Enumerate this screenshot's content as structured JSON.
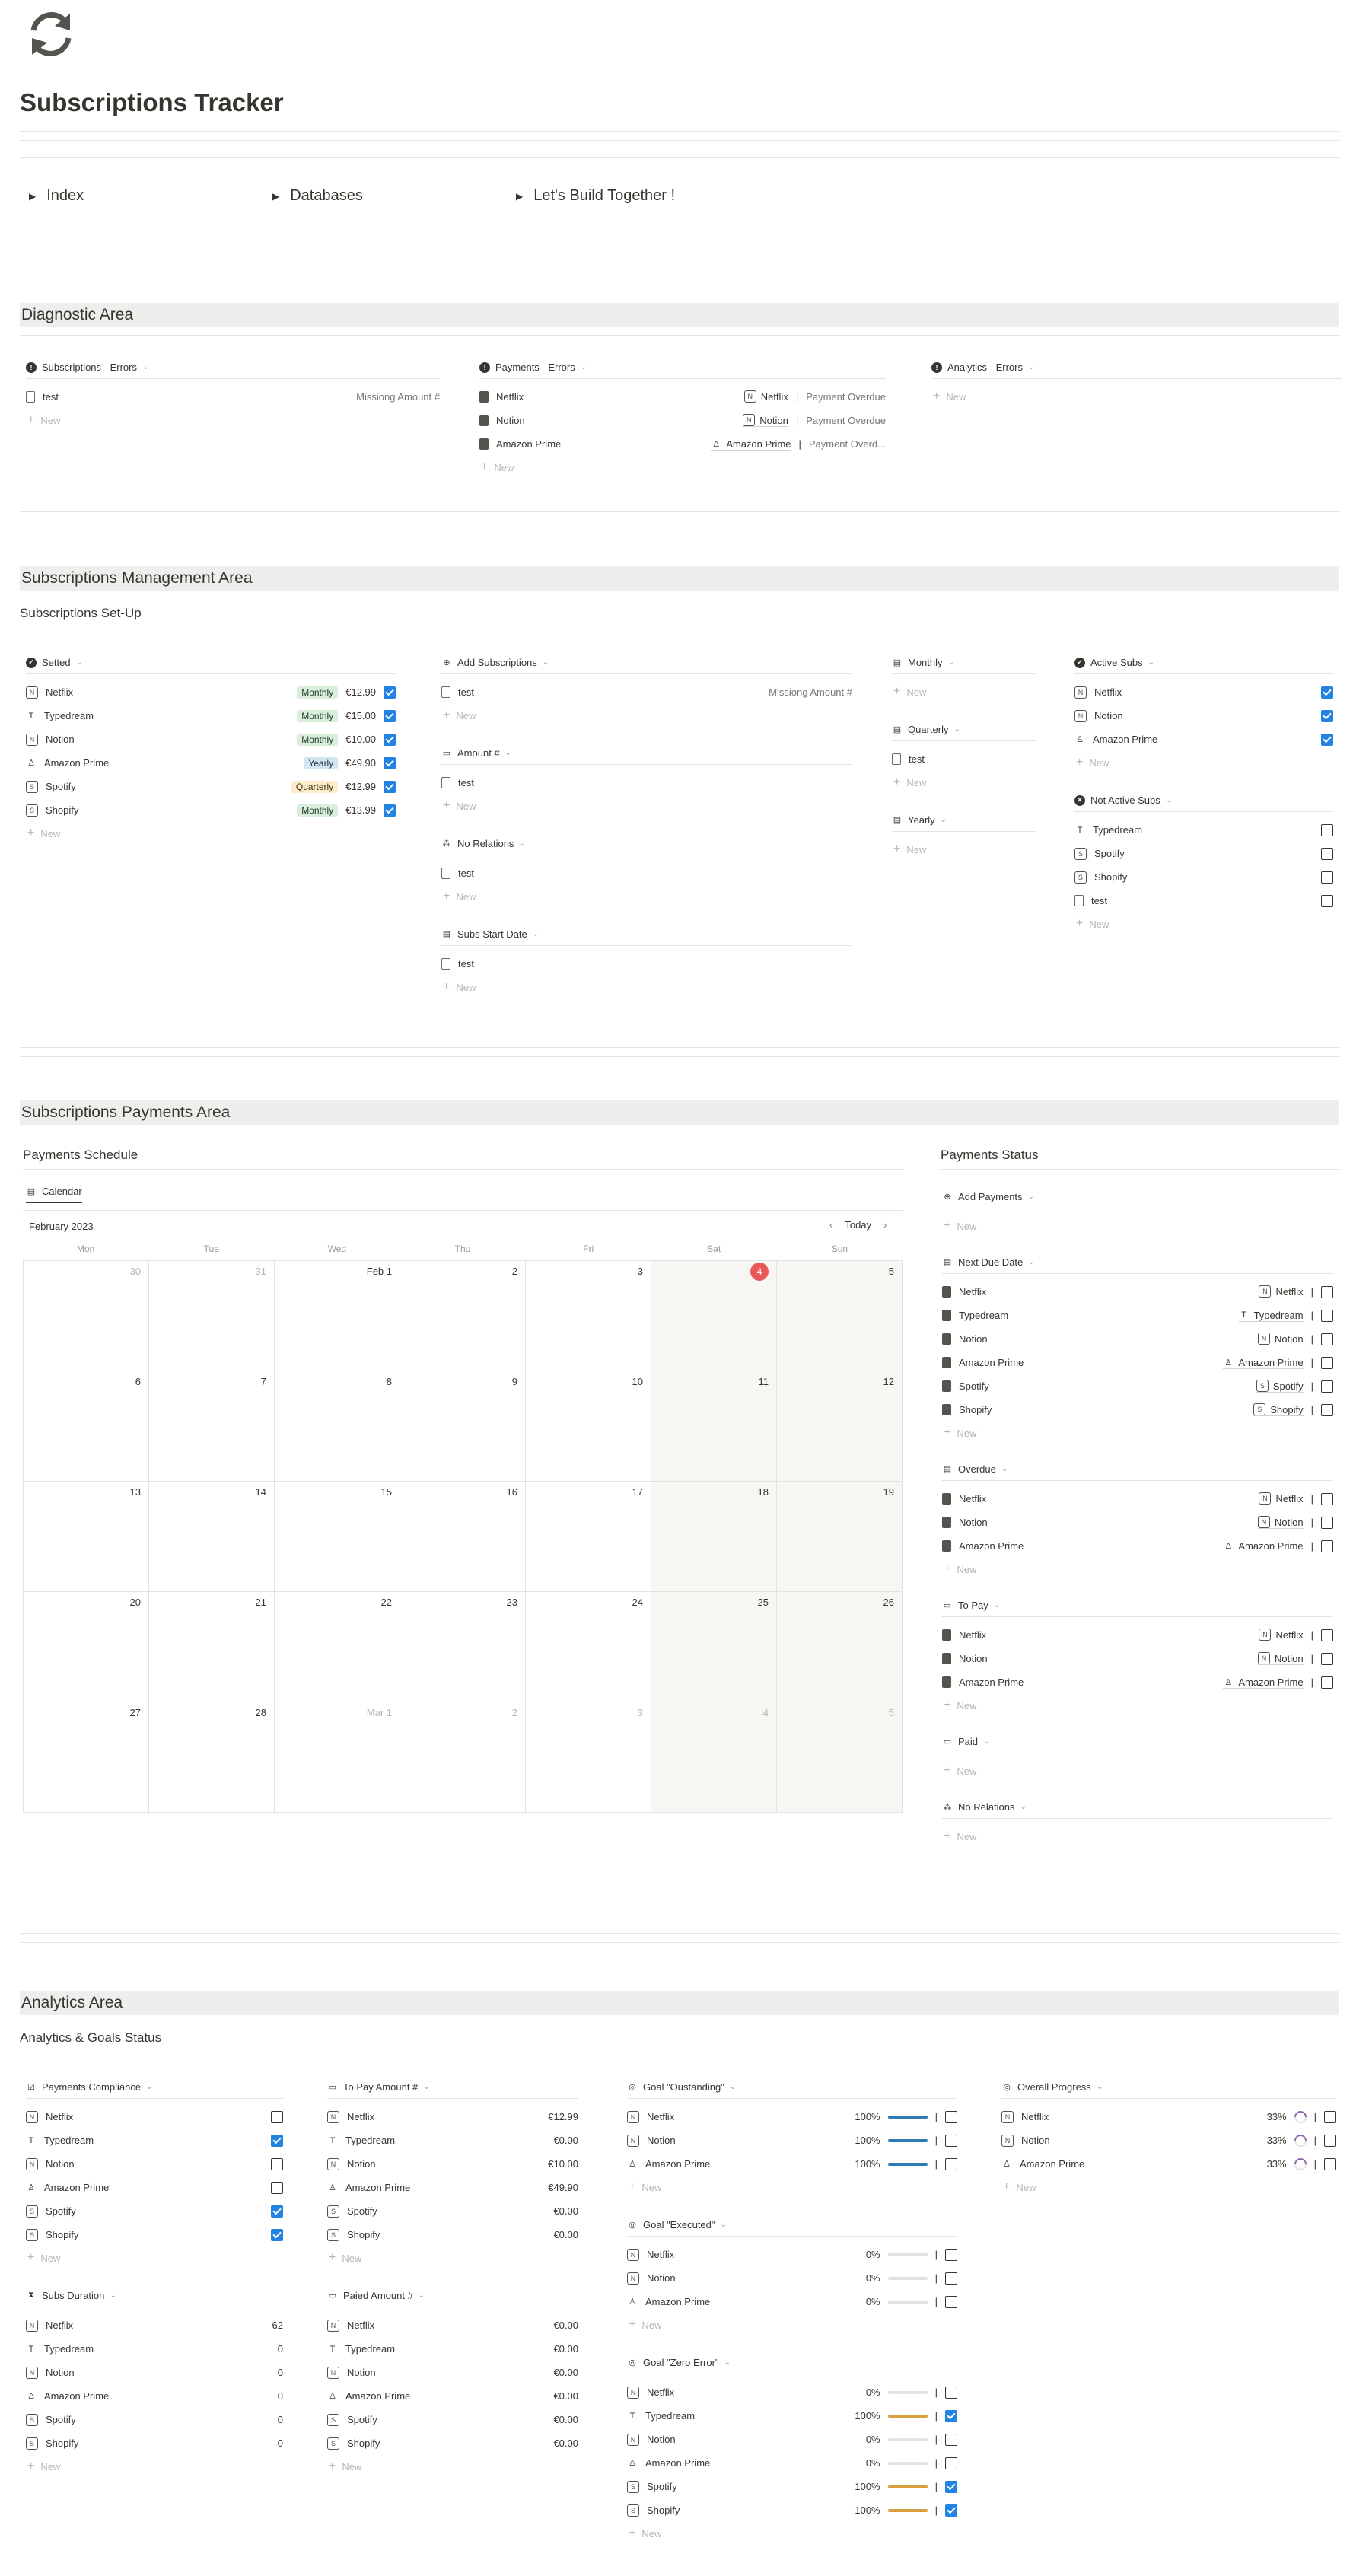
{
  "page": {
    "title": "Subscriptions Tracker",
    "icon": "refresh-arrows-icon"
  },
  "toggles": [
    "Index",
    "Databases",
    "Let's Build Together !"
  ],
  "diagnostic": {
    "title": "Diagnostic Area",
    "views": [
      {
        "label": "Subscriptions - Errors",
        "rows": [
          {
            "name": "test",
            "value": "Missiong Amount #"
          }
        ]
      },
      {
        "label": "Payments - Errors",
        "rows": [
          {
            "name": "Netflix",
            "rel": "Netflix",
            "status": "Payment Overdue"
          },
          {
            "name": "Notion",
            "rel": "Notion",
            "status": "Payment Overdue"
          },
          {
            "name": "Amazon Prime",
            "rel": "Amazon Prime",
            "status": "Payment Overd..."
          }
        ]
      },
      {
        "label": "Analytics - Errors",
        "rows": []
      }
    ]
  },
  "new_label": "New",
  "management": {
    "title": "Subscriptions Management Area",
    "subtitle": "Subscriptions Set-Up",
    "setted": {
      "label": "Setted",
      "rows": [
        {
          "name": "Netflix",
          "freq": "Monthly",
          "amount": "€12.99",
          "checked": true
        },
        {
          "name": "Typedream",
          "freq": "Monthly",
          "amount": "€15.00",
          "checked": true
        },
        {
          "name": "Notion",
          "freq": "Monthly",
          "amount": "€10.00",
          "checked": true
        },
        {
          "name": "Amazon Prime",
          "freq": "Yearly",
          "amount": "€49.90",
          "checked": true
        },
        {
          "name": "Spotify",
          "freq": "Quarterly",
          "amount": "€12.99",
          "checked": true
        },
        {
          "name": "Shopify",
          "freq": "Monthly",
          "amount": "€13.99",
          "checked": true
        }
      ]
    },
    "add_subs": {
      "label": "Add Subscriptions",
      "rows": [
        {
          "name": "test",
          "value": "Missiong Amount #"
        }
      ]
    },
    "amount": {
      "label": "Amount #",
      "rows": [
        "test"
      ]
    },
    "no_relations": {
      "label": "No Relations",
      "rows": [
        "test"
      ]
    },
    "start_date": {
      "label": "Subs Start Date",
      "rows": [
        "test"
      ]
    },
    "monthly": {
      "label": "Monthly",
      "rows": []
    },
    "quarterly": {
      "label": "Quarterly",
      "rows": [
        "test"
      ]
    },
    "yearly": {
      "label": "Yearly",
      "rows": []
    },
    "active": {
      "label": "Active Subs",
      "rows": [
        {
          "name": "Netflix",
          "checked": true
        },
        {
          "name": "Notion",
          "checked": true
        },
        {
          "name": "Amazon Prime",
          "checked": true
        }
      ]
    },
    "not_active": {
      "label": "Not Active Subs",
      "rows": [
        {
          "name": "Typedream",
          "checked": false
        },
        {
          "name": "Spotify",
          "checked": false
        },
        {
          "name": "Shopify",
          "checked": false
        },
        {
          "name": "test",
          "checked": false
        }
      ]
    }
  },
  "payments": {
    "title": "Subscriptions Payments Area",
    "schedule_title": "Payments Schedule",
    "calendar_tab": "Calendar",
    "month": "February 2023",
    "today_label": "Today",
    "weekdays": [
      "Mon",
      "Tue",
      "Wed",
      "Thu",
      "Fri",
      "Sat",
      "Sun"
    ],
    "days": [
      "30",
      "31",
      "Feb 1",
      "2",
      "3",
      "4",
      "5",
      "6",
      "7",
      "8",
      "9",
      "10",
      "11",
      "12",
      "13",
      "14",
      "15",
      "16",
      "17",
      "18",
      "19",
      "20",
      "21",
      "22",
      "23",
      "24",
      "25",
      "26",
      "27",
      "28",
      "Mar 1",
      "2",
      "3",
      "4",
      "5"
    ],
    "status_title": "Payments Status",
    "add_payments": "Add Payments",
    "next_due": {
      "label": "Next Due Date",
      "rows": [
        {
          "name": "Netflix",
          "rel": "Netflix"
        },
        {
          "name": "Typedream",
          "rel": "Typedream"
        },
        {
          "name": "Notion",
          "rel": "Notion"
        },
        {
          "name": "Amazon Prime",
          "rel": "Amazon Prime"
        },
        {
          "name": "Spotify",
          "rel": "Spotify"
        },
        {
          "name": "Shopify",
          "rel": "Shopify"
        }
      ]
    },
    "overdue": {
      "label": "Overdue",
      "rows": [
        {
          "name": "Netflix",
          "rel": "Netflix"
        },
        {
          "name": "Notion",
          "rel": "Notion"
        },
        {
          "name": "Amazon Prime",
          "rel": "Amazon Prime"
        }
      ]
    },
    "to_pay": {
      "label": "To Pay",
      "rows": [
        {
          "name": "Netflix",
          "rel": "Netflix"
        },
        {
          "name": "Notion",
          "rel": "Notion"
        },
        {
          "name": "Amazon Prime",
          "rel": "Amazon Prime"
        }
      ]
    },
    "paid": {
      "label": "Paid"
    },
    "no_relations": {
      "label": "No Relations"
    }
  },
  "analytics": {
    "title": "Analytics Area",
    "subtitle": "Analytics & Goals Status",
    "compliance": {
      "label": "Payments Compliance",
      "rows": [
        {
          "name": "Netflix",
          "checked": false
        },
        {
          "name": "Typedream",
          "checked": true
        },
        {
          "name": "Notion",
          "checked": false
        },
        {
          "name": "Amazon Prime",
          "checked": false
        },
        {
          "name": "Spotify",
          "checked": true
        },
        {
          "name": "Shopify",
          "checked": true
        }
      ]
    },
    "to_pay_amount": {
      "label": "To Pay Amount #",
      "rows": [
        {
          "name": "Netflix",
          "value": "€12.99"
        },
        {
          "name": "Typedream",
          "value": "€0.00"
        },
        {
          "name": "Notion",
          "value": "€10.00"
        },
        {
          "name": "Amazon Prime",
          "value": "€49.90"
        },
        {
          "name": "Spotify",
          "value": "€0.00"
        },
        {
          "name": "Shopify",
          "value": "€0.00"
        }
      ]
    },
    "duration": {
      "label": "Subs Duration",
      "rows": [
        {
          "name": "Netflix",
          "value": "62"
        },
        {
          "name": "Typedream",
          "value": "0"
        },
        {
          "name": "Notion",
          "value": "0"
        },
        {
          "name": "Amazon Prime",
          "value": "0"
        },
        {
          "name": "Spotify",
          "value": "0"
        },
        {
          "name": "Shopify",
          "value": "0"
        }
      ]
    },
    "paid_amount": {
      "label": "Paied Amount #",
      "rows": [
        {
          "name": "Netflix",
          "value": "€0.00"
        },
        {
          "name": "Typedream",
          "value": "€0.00"
        },
        {
          "name": "Notion",
          "value": "€0.00"
        },
        {
          "name": "Amazon Prime",
          "value": "€0.00"
        },
        {
          "name": "Spotify",
          "value": "€0.00"
        },
        {
          "name": "Shopify",
          "value": "€0.00"
        }
      ]
    },
    "goal_outstanding": {
      "label": "Goal \"Oustanding\"",
      "rows": [
        {
          "name": "Netflix",
          "pct": "100%",
          "progress": 1.0,
          "color": "#2e7bb6",
          "checked": false
        },
        {
          "name": "Notion",
          "pct": "100%",
          "progress": 1.0,
          "color": "#2e7bb6",
          "checked": false
        },
        {
          "name": "Amazon Prime",
          "pct": "100%",
          "progress": 1.0,
          "color": "#2e7bb6",
          "checked": false
        }
      ]
    },
    "goal_executed": {
      "label": "Goal \"Executed\"",
      "rows": [
        {
          "name": "Netflix",
          "pct": "0%",
          "progress": 0,
          "color": "#2e7bb6",
          "checked": false
        },
        {
          "name": "Notion",
          "pct": "0%",
          "progress": 0,
          "color": "#2e7bb6",
          "checked": false
        },
        {
          "name": "Amazon Prime",
          "pct": "0%",
          "progress": 0,
          "color": "#2e7bb6",
          "checked": false
        }
      ]
    },
    "goal_zero": {
      "label": "Goal \"Zero Error\"",
      "rows": [
        {
          "name": "Netflix",
          "pct": "0%",
          "progress": 0,
          "color": "#d9a03f",
          "checked": false
        },
        {
          "name": "Typedream",
          "pct": "100%",
          "progress": 1.0,
          "color": "#d9a03f",
          "checked": true
        },
        {
          "name": "Notion",
          "pct": "0%",
          "progress": 0,
          "color": "#d9a03f",
          "checked": false
        },
        {
          "name": "Amazon Prime",
          "pct": "0%",
          "progress": 0,
          "color": "#d9a03f",
          "checked": false
        },
        {
          "name": "Spotify",
          "pct": "100%",
          "progress": 1.0,
          "color": "#d9a03f",
          "checked": true
        },
        {
          "name": "Shopify",
          "pct": "100%",
          "progress": 1.0,
          "color": "#d9a03f",
          "checked": true
        }
      ]
    },
    "overall": {
      "label": "Overall Progress",
      "rows": [
        {
          "name": "Netflix",
          "pct": "33%",
          "checked": false
        },
        {
          "name": "Notion",
          "pct": "33%",
          "checked": false
        },
        {
          "name": "Amazon Prime",
          "pct": "33%",
          "checked": false
        }
      ]
    }
  },
  "colors": {
    "accent": "#2383e2",
    "today": "#eb5757",
    "section_bg": "#efeeec"
  }
}
